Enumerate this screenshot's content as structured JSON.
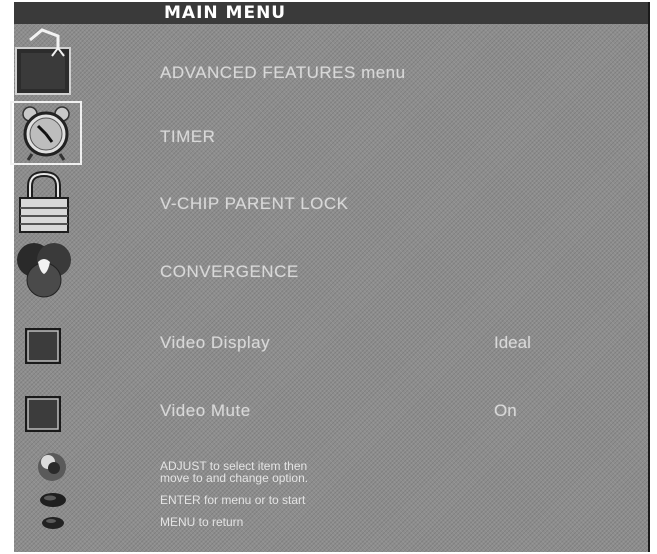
{
  "menu": {
    "title": "MAIN MENU",
    "items": [
      {
        "label": "ADVANCED FEATURES menu",
        "icon": "advanced-features-icon"
      },
      {
        "label": "TIMER",
        "icon": "clock-icon",
        "selected": true
      },
      {
        "label": "V-CHIP PARENT LOCK",
        "icon": "lock-icon"
      },
      {
        "label": "CONVERGENCE",
        "icon": "convergence-icon"
      },
      {
        "label": "Video Display",
        "value": "Ideal",
        "icon": "square-icon"
      },
      {
        "label": "Video Mute",
        "value": "On",
        "icon": "square-icon"
      }
    ]
  },
  "help": {
    "adjust_line1": "ADJUST to select item then",
    "adjust_line2": "move to and change option.",
    "enter": "ENTER for menu or to start",
    "menu": "MENU to return"
  },
  "colors": {
    "background": "#8d8d8d",
    "title_bar": "#3a3a3a",
    "text": "#d8d8d8"
  }
}
